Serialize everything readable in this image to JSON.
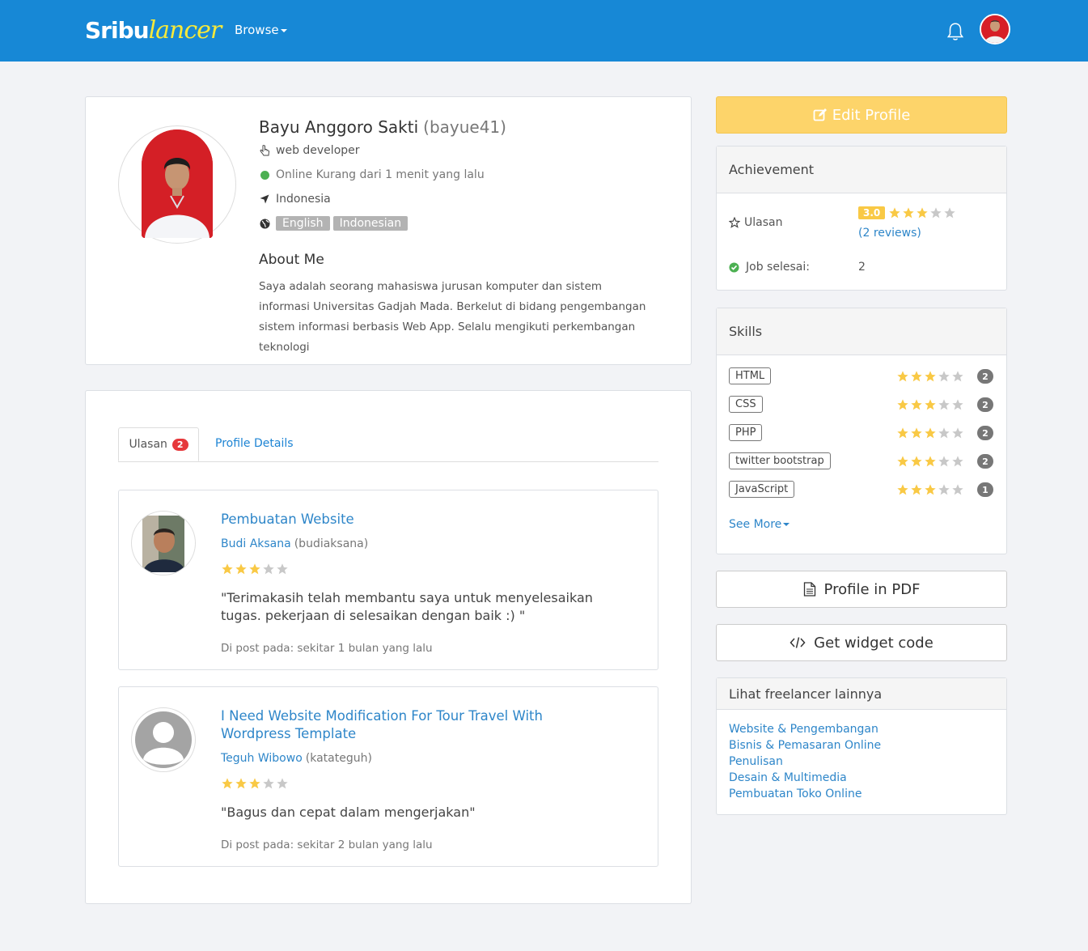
{
  "nav": {
    "logo_part1": "Sribu",
    "logo_part2": "lancer",
    "browse_label": "Browse"
  },
  "profile": {
    "name": "Bayu Anggoro Sakti",
    "username": "(bayue41)",
    "role": "web developer",
    "status": "Online Kurang dari 1 menit yang lalu",
    "location": "Indonesia",
    "languages": [
      "English",
      "Indonesian"
    ],
    "about_title": "About Me",
    "about_text": "Saya adalah seorang mahasiswa jurusan komputer dan sistem informasi Universitas Gadjah Mada. Berkelut di bidang pengembangan sistem informasi berbasis Web App. Selalu mengikuti perkembangan teknologi"
  },
  "tabs": {
    "reviews_label": "Ulasan",
    "reviews_count": "2",
    "details_label": "Profile Details"
  },
  "reviews": [
    {
      "title": "Pembuatan Website",
      "reviewer_name": "Budi Aksana",
      "reviewer_username": "(budiaksana)",
      "rating": 3,
      "text": "\"Terimakasih telah membantu saya untuk menyelesaikan tugas. pekerjaan di selesaikan dengan baik :) \"",
      "date": "Di post pada: sekitar 1 bulan yang lalu"
    },
    {
      "title": "I Need Website Modification For Tour Travel With Wordpress Template",
      "reviewer_name": "Teguh Wibowo",
      "reviewer_username": "(katateguh)",
      "rating": 3,
      "text": "\"Bagus dan cepat dalam mengerjakan\"",
      "date": "Di post pada: sekitar 2 bulan yang lalu"
    }
  ],
  "sidebar": {
    "edit_profile_label": "Edit Profile",
    "achievement": {
      "title": "Achievement",
      "reviews_label": "Ulasan",
      "rating": "3.0",
      "rating_stars": 3,
      "reviews_link": "(2 reviews)",
      "jobs_label": "Job selesai:",
      "jobs_value": "2"
    },
    "skills": {
      "title": "Skills",
      "items": [
        {
          "name": "HTML",
          "stars": 3,
          "count": "2"
        },
        {
          "name": "CSS",
          "stars": 3,
          "count": "2"
        },
        {
          "name": "PHP",
          "stars": 3,
          "count": "2"
        },
        {
          "name": "twitter bootstrap",
          "stars": 3,
          "count": "2"
        },
        {
          "name": "JavaScript",
          "stars": 3,
          "count": "1"
        }
      ],
      "see_more_label": "See More"
    },
    "pdf_label": "Profile in PDF",
    "widget_label": "Get widget code",
    "other": {
      "title": "Lihat freelancer lainnya",
      "links": [
        "Website & Pengembangan",
        "Bisnis & Pemasaran Online",
        "Penulisan",
        "Desain & Multimedia",
        "Pembuatan Toko Online"
      ]
    }
  },
  "colors": {
    "navbar": "#1788d6",
    "star_filled": "#f9c945",
    "star_empty": "#c8c8c8",
    "edit_button": "#fdd46a",
    "link": "#2e86c9",
    "online": "#4cb052"
  }
}
